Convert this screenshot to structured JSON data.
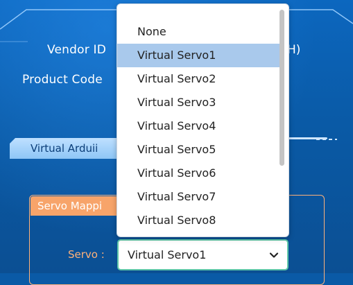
{
  "labels": {
    "vendor_id": "Vendor ID",
    "product_code": "Product Code",
    "right_fragment": "H)",
    "virtual_tab": "Virtual Arduii",
    "servo_mapping_tab": "Servo Mappi",
    "servo_label": "Servo :"
  },
  "servo_select": {
    "value": "Virtual Servo1",
    "options": [
      "None",
      "Virtual Servo1",
      "Virtual Servo2",
      "Virtual Servo3",
      "Virtual Servo4",
      "Virtual Servo5",
      "Virtual Servo6",
      "Virtual Servo7",
      "Virtual Servo8"
    ],
    "highlighted": "Virtual Servo1"
  },
  "icons": {
    "arrow": "chevron-down-icon"
  },
  "colors": {
    "background": "#0a5aa6",
    "accent_orange": "#f7a46a",
    "select_border": "#5fc7a8",
    "highlight": "#a9c9ec"
  }
}
